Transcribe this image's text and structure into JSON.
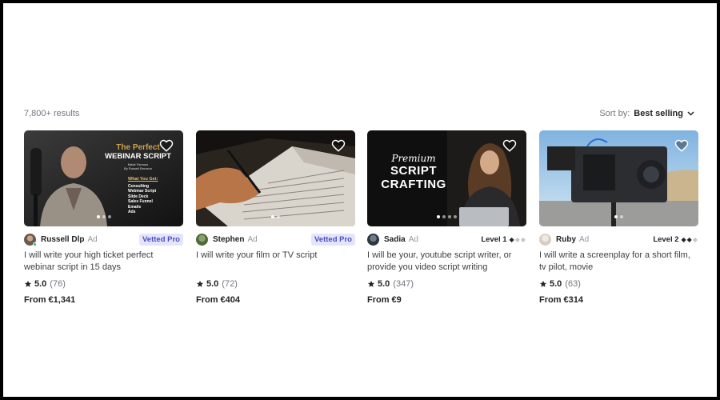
{
  "results": {
    "count": "7,800+ results"
  },
  "sort": {
    "label": "Sort by:",
    "value": "Best selling"
  },
  "colors": {
    "vetted_bg": "#e4e5fb",
    "vetted_text": "#4a4dc4",
    "online": "#1dbf73"
  },
  "gigs": [
    {
      "seller": "Russell Dlp",
      "ad": "Ad",
      "badge": "Vetted Pro",
      "level": "",
      "title": "I will write your high ticket perfect webinar script in 15 days",
      "rating": "5.0",
      "reviews": "(76)",
      "price": "From €1,341",
      "thumb_text": {
        "line1": "The Perfect",
        "line2": "WEBINAR SCRIPT",
        "line3": "Made Famous",
        "line4": "By Russell Brunson",
        "heading": "What You Get:",
        "items": [
          "Consulting",
          "Webinar Script",
          "Slide Deck",
          "Sales Funnel",
          "Emails",
          "Ads"
        ]
      }
    },
    {
      "seller": "Stephen",
      "ad": "Ad",
      "badge": "Vetted Pro",
      "level": "",
      "title": "I will write your film or TV script",
      "rating": "5.0",
      "reviews": "(72)",
      "price": "From €404"
    },
    {
      "seller": "Sadia",
      "ad": "Ad",
      "badge": "",
      "level": "Level 1",
      "title": "I will be your, youtube script writer, or provide you video script writing",
      "rating": "5.0",
      "reviews": "(347)",
      "price": "From €9",
      "thumb_text": {
        "script": "Premium",
        "line1": "SCRIPT",
        "line2": "CRAFTING"
      }
    },
    {
      "seller": "Ruby",
      "ad": "Ad",
      "badge": "",
      "level": "Level 2",
      "title": "I will write a screenplay for a short film, tv pilot, movie",
      "rating": "5.0",
      "reviews": "(63)",
      "price": "From €314"
    }
  ]
}
